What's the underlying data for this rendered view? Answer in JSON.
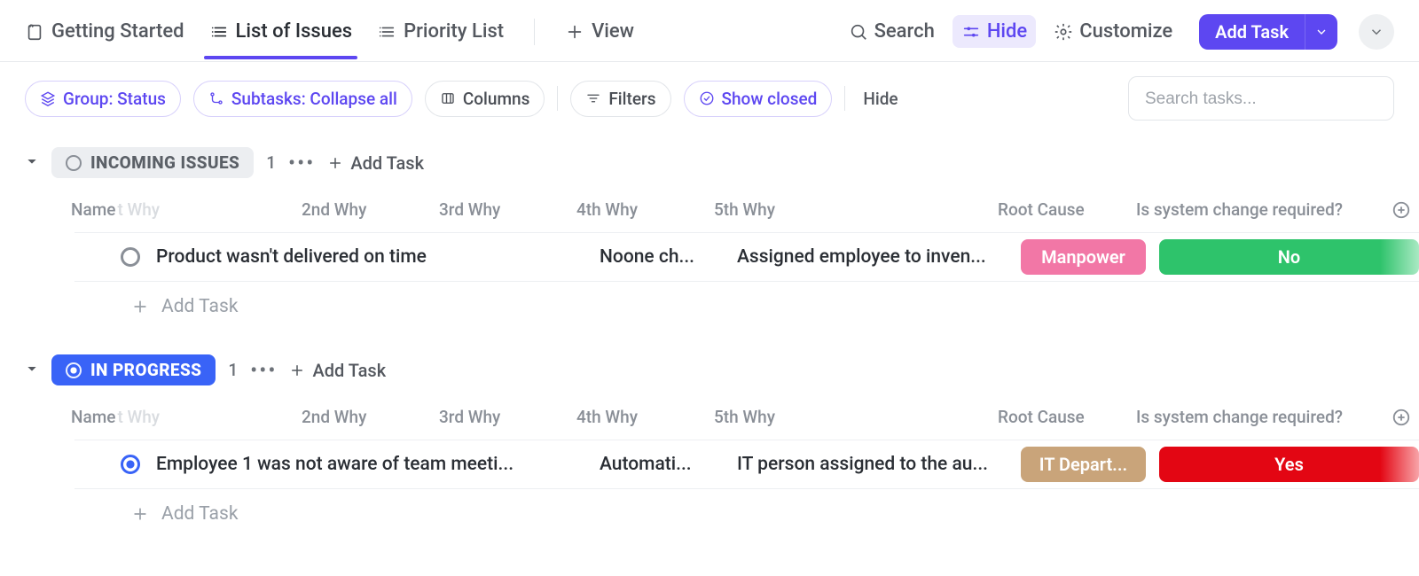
{
  "topbar": {
    "tabs": [
      {
        "label": "Getting Started",
        "active": false
      },
      {
        "label": "List of Issues",
        "active": true
      },
      {
        "label": "Priority List",
        "active": false
      }
    ],
    "view_label": "View",
    "search_label": "Search",
    "hide_label": "Hide",
    "customize_label": "Customize",
    "add_task_label": "Add Task"
  },
  "filterbar": {
    "group_label": "Group: Status",
    "subtasks_label": "Subtasks: Collapse all",
    "columns_label": "Columns",
    "filters_label": "Filters",
    "show_closed_label": "Show closed",
    "hide_label": "Hide",
    "search_placeholder": "Search tasks..."
  },
  "columns": {
    "name": "Name",
    "first_why_ghost": "t Why",
    "why2": "2nd Why",
    "why3": "3rd Why",
    "why4": "4th Why",
    "why5": "5th Why",
    "root": "Root Cause",
    "sys": "Is system change required?"
  },
  "groups": [
    {
      "status_label": "INCOMING ISSUES",
      "status_key": "inc",
      "count": "1",
      "add_label": "Add Task",
      "tasks": [
        {
          "name": "Product wasn't delivered on time",
          "why4": "Noone ch...",
          "why5": "Assigned employee to inven...",
          "root": "Manpower",
          "root_class": "manpower",
          "sys": "No",
          "sys_class": "no"
        }
      ],
      "add_row": "Add Task"
    },
    {
      "status_label": "IN PROGRESS",
      "status_key": "prog",
      "count": "1",
      "add_label": "Add Task",
      "tasks": [
        {
          "name": "Employee 1 was not aware of team meeti...",
          "why4": "Automati...",
          "why5": "IT person assigned to the au...",
          "root": "IT Depart...",
          "root_class": "itd",
          "sys": "Yes",
          "sys_class": "yes"
        }
      ],
      "add_row": "Add Task"
    }
  ]
}
